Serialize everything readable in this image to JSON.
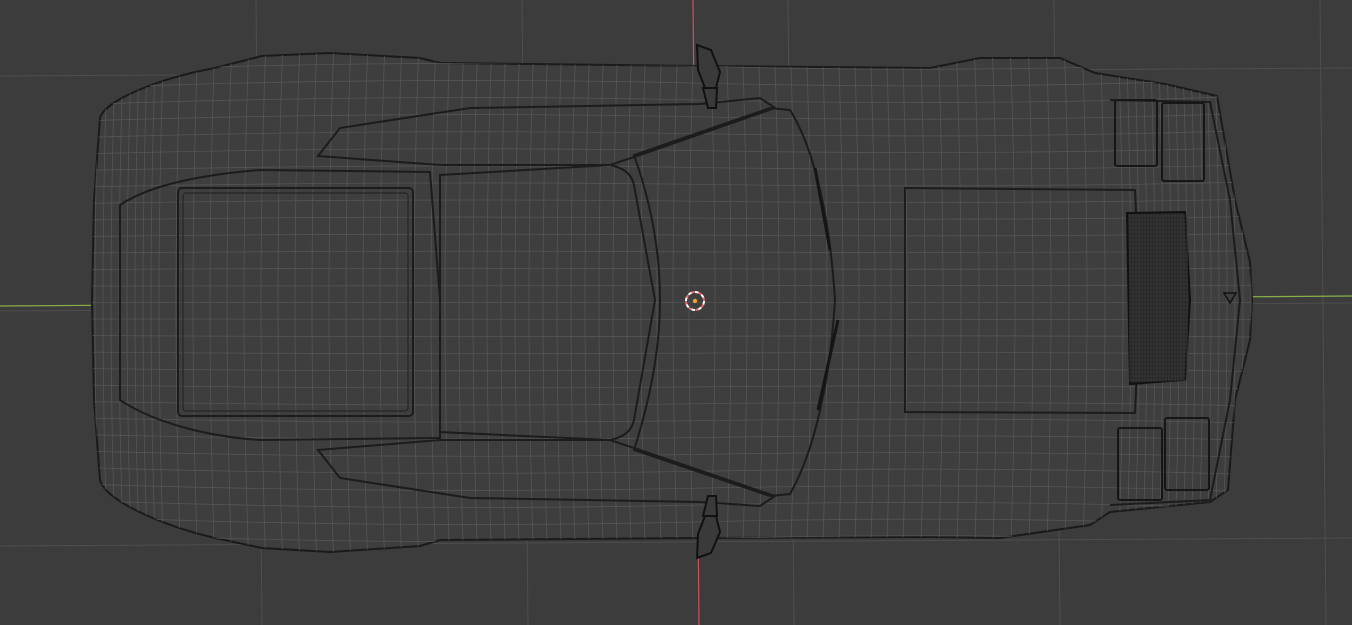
{
  "viewport": {
    "view": "top-orthographic",
    "shading": "wireframe",
    "colors": {
      "background": "#3c3c3c",
      "grid_line": "#4e4e4e",
      "x_axis": "#88b04a",
      "y_axis": "#d0505a",
      "wire_light": "#555555",
      "wire_dark": "#1c1c1c",
      "vent_fill": "#262626",
      "cursor_red": "#f06a6a",
      "cursor_white": "#ffffff",
      "origin": "#f0a030"
    }
  },
  "mesh": {
    "object": "sports-car",
    "icon": "car-mesh-icon"
  },
  "cursor_3d": {
    "icon": "3d-cursor-icon"
  }
}
